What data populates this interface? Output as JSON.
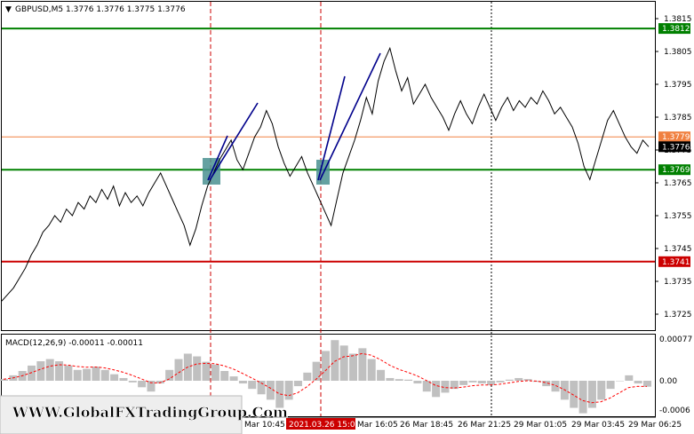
{
  "header": {
    "symbol_line": "GBPUSD,M5  1.3776 1.3776 1.3775 1.3776",
    "menu_glyph": "▼"
  },
  "watermark": "WWW.GlobalFXTradingGroup.Com",
  "macd": {
    "label": "MACD(12,26,9) -0.00011 -0.00011",
    "axis_labels": [
      "0.00077",
      "0.00",
      "-0.0006"
    ]
  },
  "price_axis": {
    "ticks": [
      "1.3815",
      "1.3805",
      "1.3795",
      "1.3785",
      "1.3775",
      "1.3765",
      "1.3755",
      "1.3745",
      "1.3735",
      "1.3725"
    ]
  },
  "levels": [
    {
      "name": "level-1-3812",
      "price": 1.3812,
      "label": "1.3812",
      "color": "#008000"
    },
    {
      "name": "level-1-3779",
      "price": 1.3779,
      "label": "1.3779",
      "color": "#f08040"
    },
    {
      "name": "level-1-3776",
      "price": 1.3776,
      "label": "1.3776",
      "color": "#000000"
    },
    {
      "name": "level-1-3769",
      "price": 1.3769,
      "label": "1.3769",
      "color": "#008000"
    },
    {
      "name": "level-1-3741",
      "price": 1.3741,
      "label": "1.3741",
      "color": "#cc0000"
    }
  ],
  "time_axis": {
    "labels": [
      "Mar 10:45",
      "2021.03.26 15:00",
      "Mar 16:05",
      "26 Mar 18:45",
      "26 Mar 21:25",
      "29 Mar 01:05",
      "29 Mar 03:45",
      "29 Mar 06:25"
    ],
    "highlight_label": "2021.03.26 15:00"
  },
  "colors": {
    "price_line": "#000000",
    "support_green": "#008000",
    "resistance_red": "#cc0000",
    "mid_orange": "#f08040",
    "trend_blue": "#00008b",
    "zone_teal": "#4a9090",
    "macd_hist": "#c0c0c0",
    "macd_signal": "#ff0000"
  },
  "chart_data": {
    "type": "line",
    "title": "GBPUSD,M5",
    "ylim": [
      1.3718,
      1.382
    ],
    "series": [
      {
        "name": "GBPUSD",
        "values": [
          1.3729,
          1.3731,
          1.3733,
          1.3736,
          1.3739,
          1.3743,
          1.3746,
          1.375,
          1.3752,
          1.3755,
          1.3753,
          1.3757,
          1.3755,
          1.3759,
          1.3757,
          1.3761,
          1.3759,
          1.3763,
          1.376,
          1.3764,
          1.3758,
          1.3762,
          1.3759,
          1.3761,
          1.3758,
          1.3762,
          1.3765,
          1.3768,
          1.3764,
          1.376,
          1.3756,
          1.3752,
          1.3746,
          1.3751,
          1.3758,
          1.3764,
          1.3768,
          1.3772,
          1.3775,
          1.3778,
          1.3772,
          1.3769,
          1.3774,
          1.3779,
          1.3782,
          1.3787,
          1.3783,
          1.3776,
          1.3771,
          1.3767,
          1.377,
          1.3773,
          1.3768,
          1.3764,
          1.376,
          1.3756,
          1.3752,
          1.376,
          1.3768,
          1.3773,
          1.3778,
          1.3784,
          1.3791,
          1.3786,
          1.3796,
          1.3802,
          1.3806,
          1.3799,
          1.3793,
          1.3797,
          1.3789,
          1.3792,
          1.3795,
          1.3791,
          1.3788,
          1.3785,
          1.3781,
          1.3786,
          1.379,
          1.3786,
          1.3783,
          1.3788,
          1.3792,
          1.3788,
          1.3784,
          1.3788,
          1.3791,
          1.3787,
          1.379,
          1.3788,
          1.3791,
          1.3789,
          1.3793,
          1.379,
          1.3786,
          1.3788,
          1.3785,
          1.3782,
          1.3777,
          1.377,
          1.3766,
          1.3772,
          1.3778,
          1.3784,
          1.3787,
          1.3783,
          1.3779,
          1.3776,
          1.3774,
          1.3778,
          1.3776
        ]
      },
      {
        "name": "MACD",
        "values": [
          3e-05,
          0.0001,
          0.00018,
          0.00028,
          0.00036,
          0.0004,
          0.00036,
          0.00028,
          0.0002,
          0.00022,
          0.00026,
          0.0002,
          0.00012,
          5e-05,
          -3e-05,
          -0.00012,
          -0.0002,
          -5e-05,
          0.0002,
          0.0004,
          0.0005,
          0.00045,
          0.00035,
          0.0003,
          0.00018,
          8e-05,
          -5e-05,
          -0.00015,
          -0.00025,
          -0.00035,
          -0.0005,
          -0.00035,
          -0.0001,
          0.00015,
          0.00035,
          0.00055,
          0.00075,
          0.00065,
          0.0005,
          0.0006,
          0.0004,
          0.0002,
          5e-05,
          3e-05,
          2e-05,
          -5e-05,
          -0.0002,
          -0.0003,
          -0.00022,
          -0.00015,
          -8e-05,
          -3e-05,
          -5e-05,
          -8e-05,
          -3e-05,
          2e-05,
          5e-05,
          3e-05,
          -2e-05,
          -0.0001,
          -0.0002,
          -0.00035,
          -0.0005,
          -0.0006,
          -0.0005,
          -0.00035,
          -0.00015,
          0.0,
          0.0001,
          -5e-05,
          -0.00011
        ]
      }
    ]
  }
}
